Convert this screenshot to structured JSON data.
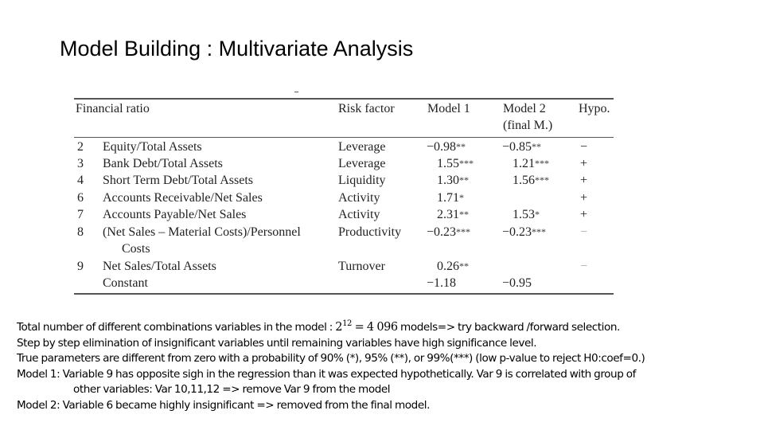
{
  "slide": {
    "title": "Model Building : Multivariate Analysis"
  },
  "table": {
    "headers": {
      "financial_ratio": "Financial ratio",
      "risk_factor": "Risk factor",
      "model1": "Model 1",
      "model2_line1": "Model 2",
      "model2_line2": "(final M.)",
      "hypo": "Hypo."
    },
    "rows": [
      {
        "num": "2",
        "ratio": "Equity/Total Assets",
        "ratio_cont": "",
        "risk": "Leverage",
        "m1": "−0.98",
        "m1_sig": "**",
        "m2": "−0.85",
        "m2_sig": "**",
        "hypo": "−"
      },
      {
        "num": "3",
        "ratio": "Bank Debt/Total Assets",
        "ratio_cont": "",
        "risk": "Leverage",
        "m1": "1.55",
        "m1_sig": "***",
        "m2": "1.21",
        "m2_sig": "***",
        "hypo": "+"
      },
      {
        "num": "4",
        "ratio": "Short Term Debt/Total Assets",
        "ratio_cont": "",
        "risk": "Liquidity",
        "m1": "1.30",
        "m1_sig": "**",
        "m2": "1.56",
        "m2_sig": "***",
        "hypo": "+"
      },
      {
        "num": "6",
        "ratio": "Accounts Receivable/Net Sales",
        "ratio_cont": "",
        "risk": "Activity",
        "m1": "1.71",
        "m1_sig": "*",
        "m2": "",
        "m2_sig": "",
        "hypo": "+"
      },
      {
        "num": "7",
        "ratio": "Accounts Payable/Net Sales",
        "ratio_cont": "",
        "risk": "Activity",
        "m1": "2.31",
        "m1_sig": "**",
        "m2": "1.53",
        "m2_sig": "*",
        "hypo": "+"
      },
      {
        "num": "8",
        "ratio": "(Net Sales – Material Costs)/Personnel",
        "ratio_cont": "Costs",
        "risk": "Productivity",
        "m1": "−0.23",
        "m1_sig": "***",
        "m2": "−0.23",
        "m2_sig": "***",
        "hypo": "−"
      },
      {
        "num": "9",
        "ratio": "Net Sales/Total Assets",
        "ratio_cont": "",
        "risk": "Turnover",
        "m1": "0.26",
        "m1_sig": "**",
        "m2": "",
        "m2_sig": "",
        "hypo": "−"
      },
      {
        "num": "",
        "ratio": "Constant",
        "ratio_cont": "",
        "risk": "",
        "m1": "−1.18",
        "m1_sig": "",
        "m2": "−0.95",
        "m2_sig": "",
        "hypo": ""
      }
    ]
  },
  "notes": {
    "line1_pre": "Total number of different combinations variables in the model : ",
    "line1_base": "2",
    "line1_exp": "12",
    "line1_eq": " = 4 096",
    "line1_post": " models=> try backward /forward selection.",
    "line2": "Step by step elimination of insignificant variables until remaining variables have high significance level.",
    "line3": "True parameters are different from zero with a probability of 90% (*), 95% (**), or 99%(***) (low p-value to reject H0:coef=0.)",
    "line4": "Model 1: Variable 9 has opposite sigh in the regression than it was expected hypothetically. Var 9 is correlated with group of",
    "line5": "other variables: Var 10,11,12 => remove Var 9 from the model",
    "line6": "Model 2: Variable 6 became highly insignificant => removed from the final model."
  }
}
